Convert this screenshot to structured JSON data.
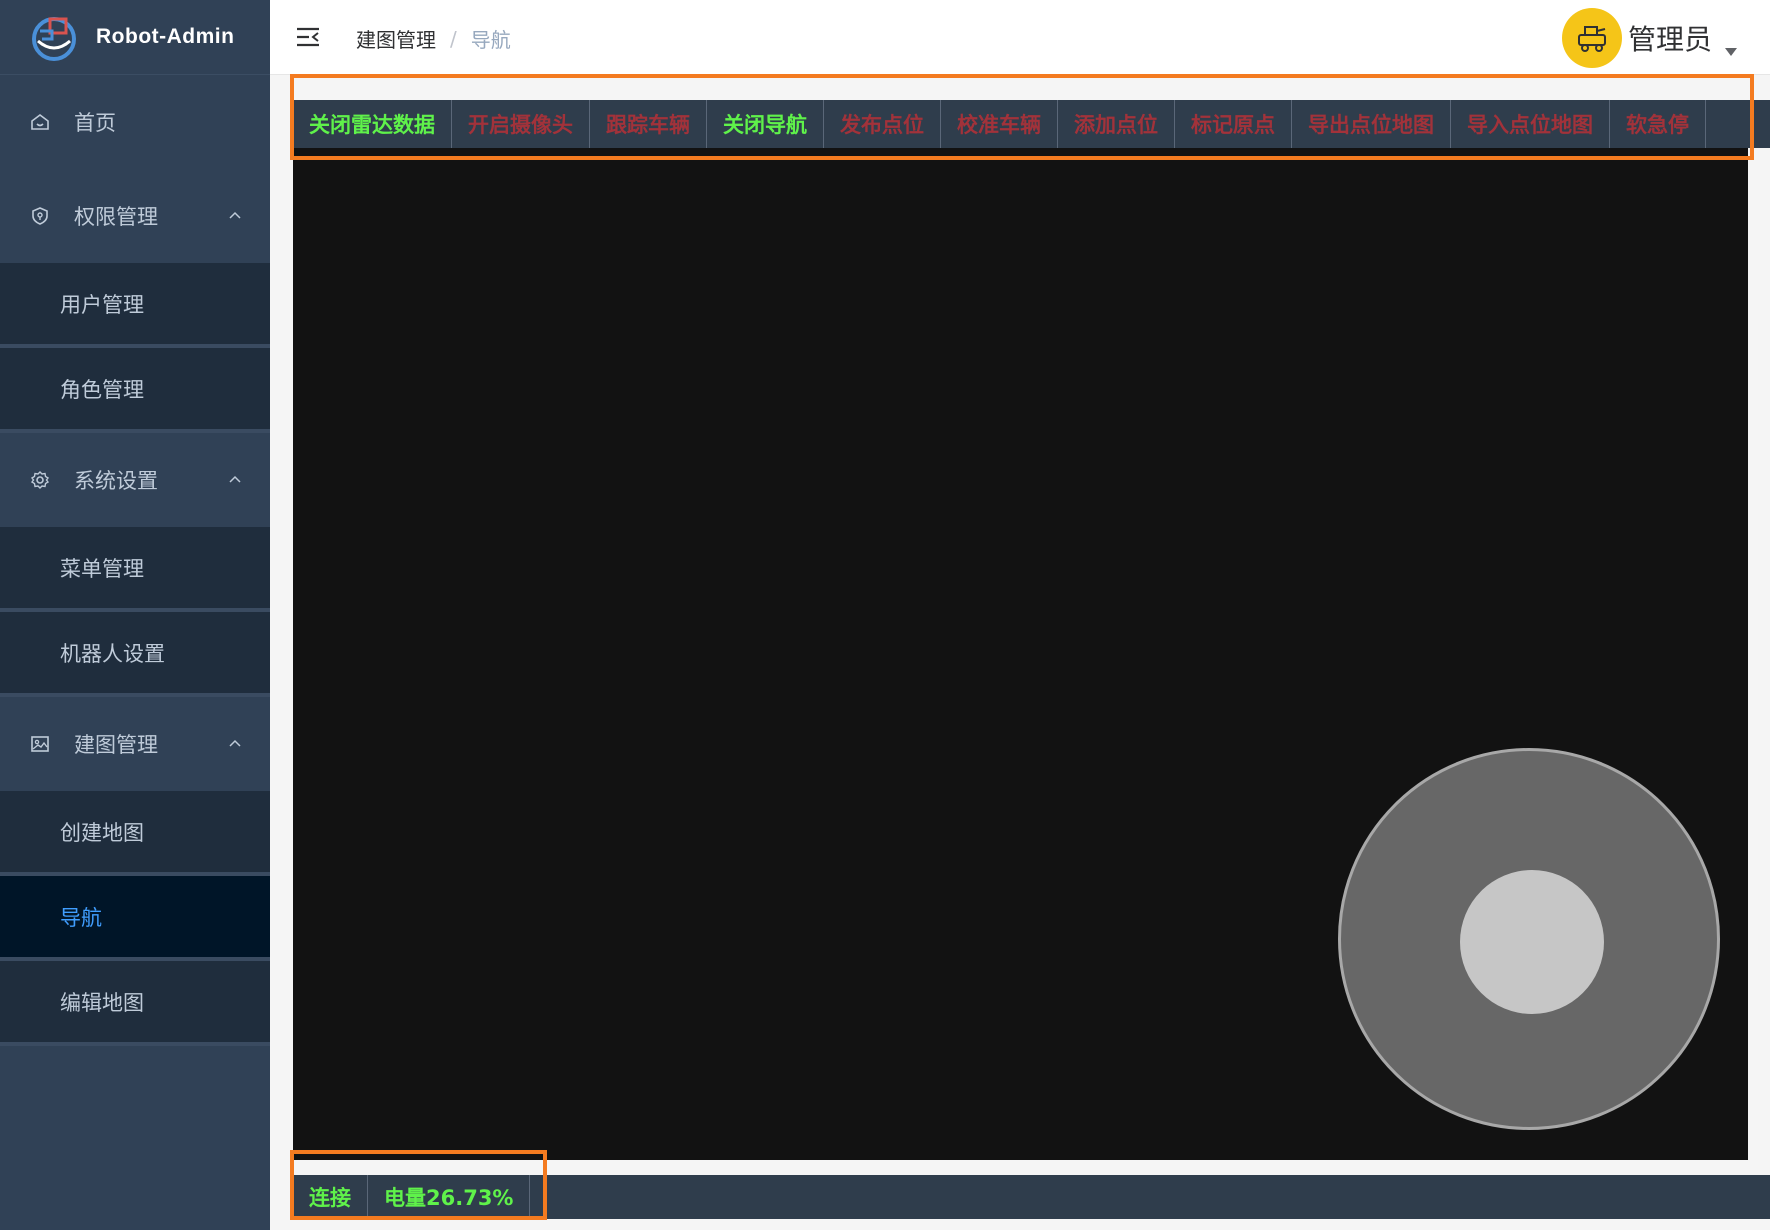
{
  "app": {
    "title": "Robot-Admin"
  },
  "sidebar": {
    "items": [
      {
        "label": "首页",
        "icon": "home-icon"
      },
      {
        "label": "权限管理",
        "icon": "shield-icon",
        "children": [
          {
            "label": "用户管理"
          },
          {
            "label": "角色管理"
          }
        ]
      },
      {
        "label": "系统设置",
        "icon": "gear-icon",
        "children": [
          {
            "label": "菜单管理"
          },
          {
            "label": "机器人设置"
          }
        ]
      },
      {
        "label": "建图管理",
        "icon": "image-icon",
        "children": [
          {
            "label": "创建地图"
          },
          {
            "label": "导航",
            "active": true
          },
          {
            "label": "编辑地图"
          }
        ]
      }
    ]
  },
  "header": {
    "breadcrumb": {
      "parent": "建图管理",
      "separator": "/",
      "current": "导航"
    },
    "user": {
      "name": "管理员",
      "avatar_color": "#f5c518"
    }
  },
  "toolbar": {
    "buttons": [
      {
        "label": "关闭雷达数据",
        "state": "on"
      },
      {
        "label": "开启摄像头",
        "state": "off"
      },
      {
        "label": "跟踪车辆",
        "state": "off"
      },
      {
        "label": "关闭导航",
        "state": "on"
      },
      {
        "label": "发布点位",
        "state": "off"
      },
      {
        "label": "校准车辆",
        "state": "off"
      },
      {
        "label": "添加点位",
        "state": "off"
      },
      {
        "label": "标记原点",
        "state": "off"
      },
      {
        "label": "导出点位地图",
        "state": "off"
      },
      {
        "label": "导入点位地图",
        "state": "off"
      },
      {
        "label": "软急停",
        "state": "off"
      }
    ]
  },
  "status": {
    "connection": "连接",
    "battery": "电量26.73%"
  },
  "colors": {
    "sidebar_bg": "#304156",
    "active_text": "#409eff",
    "on_green": "#5ff24a",
    "off_red": "#a2323a",
    "highlight_orange": "#f47b20"
  }
}
